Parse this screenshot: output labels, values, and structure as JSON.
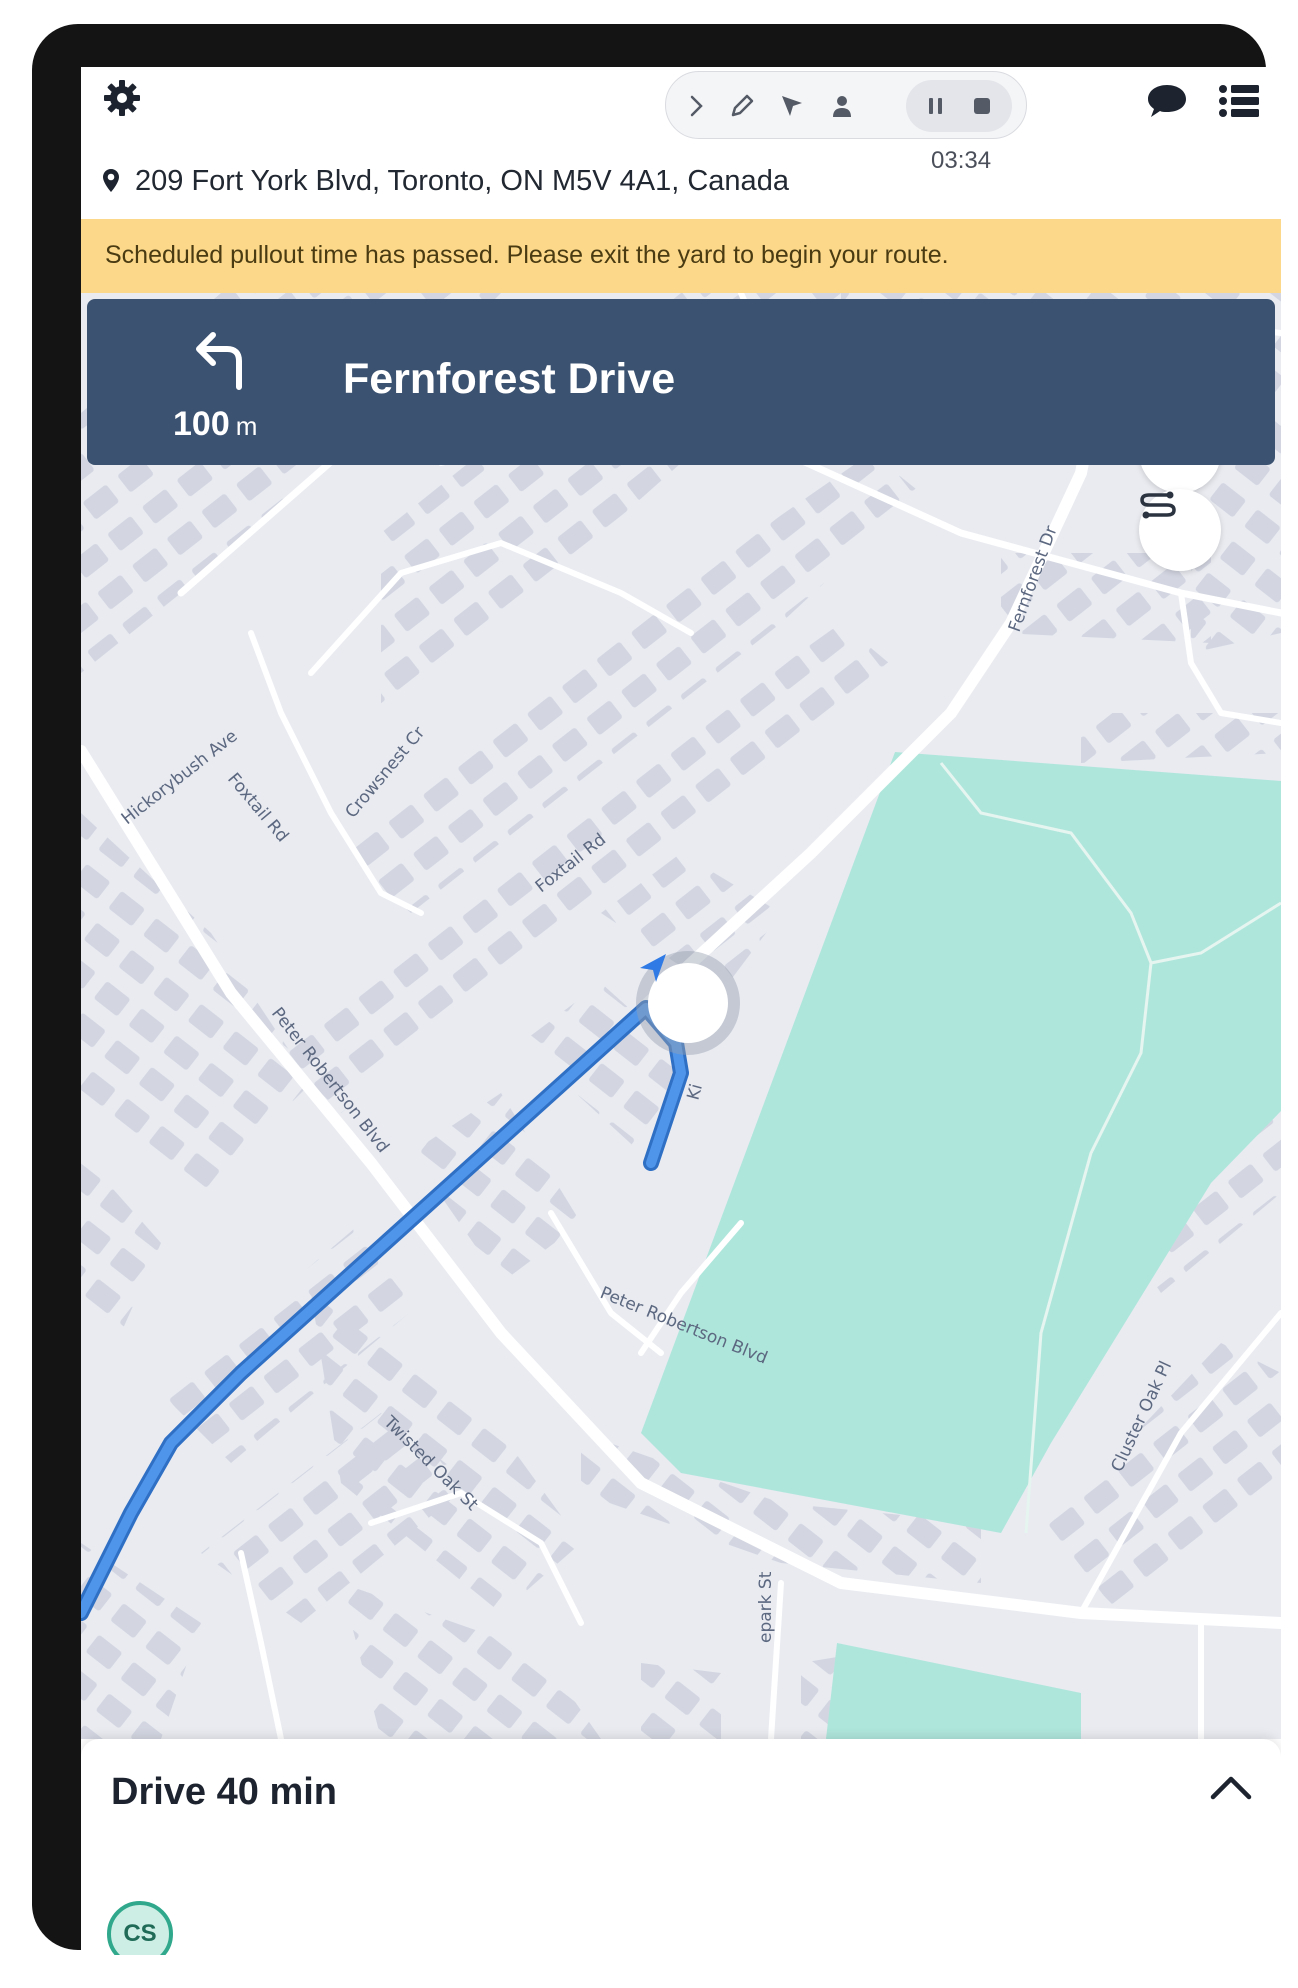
{
  "header": {
    "address": "209 Fort York Blvd, Toronto, ON M5V 4A1, Canada",
    "timer": "03:34"
  },
  "toolbar": {
    "icons": [
      "chevron-right-icon",
      "pencil-icon",
      "cursor-arrow-icon",
      "person-icon",
      "pause-icon",
      "stop-icon"
    ]
  },
  "banner": {
    "message": "Scheduled pullout time has passed. Please exit the yard to begin your route."
  },
  "navigation": {
    "distance_value": "100",
    "distance_unit": "m",
    "street": "Fernforest Drive",
    "turn": "left"
  },
  "map": {
    "street_labels": [
      "Fernforest Dr",
      "Hickorybush Ave",
      "Crowsnest Cr",
      "Foxtail Rd",
      "Foxtail Rd",
      "Peter Robertson Blvd",
      "Peter Robertson Blvd",
      "Twisted Oak St",
      "Cluster Oak Pl",
      "epark St",
      "Ki"
    ],
    "colors": {
      "route": "#4f95ea",
      "park": "#afe6dc",
      "land": "#e9ebf1",
      "road": "#ffffff",
      "building": "#d3d6e1"
    }
  },
  "sheet": {
    "title": "Drive 40 min",
    "avatar_initials": "CS"
  },
  "colors": {
    "accent": "#3b5270",
    "banner": "#fcd98a",
    "avatar": "#2fa88c"
  }
}
